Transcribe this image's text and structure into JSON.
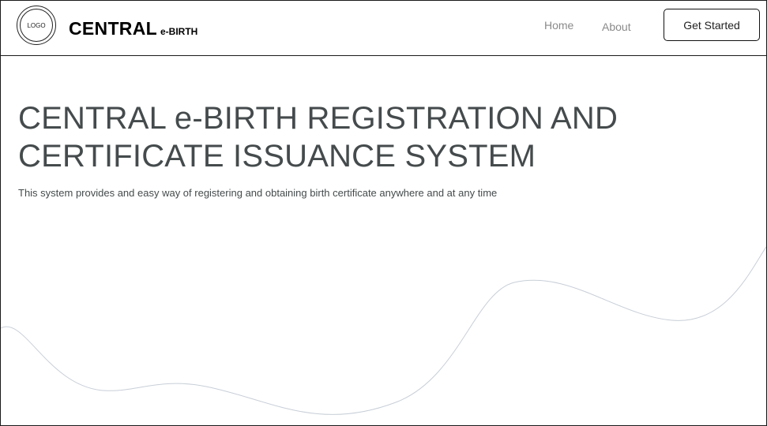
{
  "header": {
    "logo_text": "LOGO",
    "brand_main": "CENTRAL",
    "brand_sub": "e-BIRTH",
    "nav": {
      "home": "Home",
      "about": "About"
    },
    "cta_label": "Get Started"
  },
  "hero": {
    "title": "CENTRAL e-BIRTH REGISTRATION AND CERTIFICATE ISSUANCE SYSTEM",
    "subtitle": "This system provides and easy way of registering and obtaining birth certificate anywhere and at any time"
  },
  "colors": {
    "title_text": "#454b4c",
    "nav_text": "#8a8a8a",
    "border": "#1a1a1a",
    "wave_line": "#c8cfd8"
  }
}
